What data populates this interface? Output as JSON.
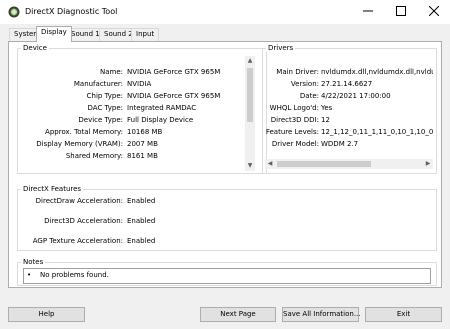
{
  "window": {
    "title": "DirectX Diagnostic Tool",
    "icon": "directx-icon",
    "controls": [
      "minimize-icon",
      "maximize-icon",
      "close-icon"
    ]
  },
  "tabs": [
    "System",
    "Display",
    "Sound 1",
    "Sound 2",
    "Input"
  ],
  "active_tab": "Display",
  "device": {
    "heading": "Device",
    "rows": [
      {
        "label": "Name:",
        "value": "NVIDIA GeForce GTX 965M"
      },
      {
        "label": "Manufacturer:",
        "value": "NVIDIA"
      },
      {
        "label": "Chip Type:",
        "value": "NVIDIA GeForce GTX 965M"
      },
      {
        "label": "DAC Type:",
        "value": "Integrated RAMDAC"
      },
      {
        "label": "Device Type:",
        "value": "Full Display Device"
      },
      {
        "label": "Approx. Total Memory:",
        "value": "10168 MB"
      },
      {
        "label": "Display Memory (VRAM):",
        "value": "2007 MB"
      },
      {
        "label": "Shared Memory:",
        "value": "8161 MB"
      }
    ]
  },
  "drivers": {
    "heading": "Drivers",
    "rows": [
      {
        "label": "Main Driver:",
        "value": "nvldumdx.dll,nvldumdx.dll,nvldumdx.d"
      },
      {
        "label": "Version:",
        "value": "27.21.14.6627"
      },
      {
        "label": "Date:",
        "value": "4/22/2021 17:00:00"
      },
      {
        "label": "WHQL Logo'd:",
        "value": "Yes"
      },
      {
        "label": "Direct3D DDI:",
        "value": "12"
      },
      {
        "label": "Feature Levels:",
        "value": "12_1,12_0,11_1,11_0,10_1,10_0,9_3"
      },
      {
        "label": "Driver Model:",
        "value": "WDDM 2.7"
      }
    ]
  },
  "directx_features": {
    "heading": "DirectX Features",
    "rows": [
      {
        "label": "DirectDraw Acceleration:",
        "value": "Enabled"
      },
      {
        "label": "Direct3D Acceleration:",
        "value": "Enabled"
      },
      {
        "label": "AGP Texture Acceleration:",
        "value": "Enabled"
      }
    ]
  },
  "notes": {
    "heading": "Notes",
    "items": [
      "No problems found."
    ]
  },
  "buttons": {
    "help": "Help",
    "next_page": "Next Page",
    "save_all": "Save All Information...",
    "exit": "Exit"
  },
  "colors": {
    "dialog_bg": "#f0f0f0",
    "panel_bg": "#ffffff",
    "button_bg": "#e1e1e1",
    "border": "#adadad"
  }
}
